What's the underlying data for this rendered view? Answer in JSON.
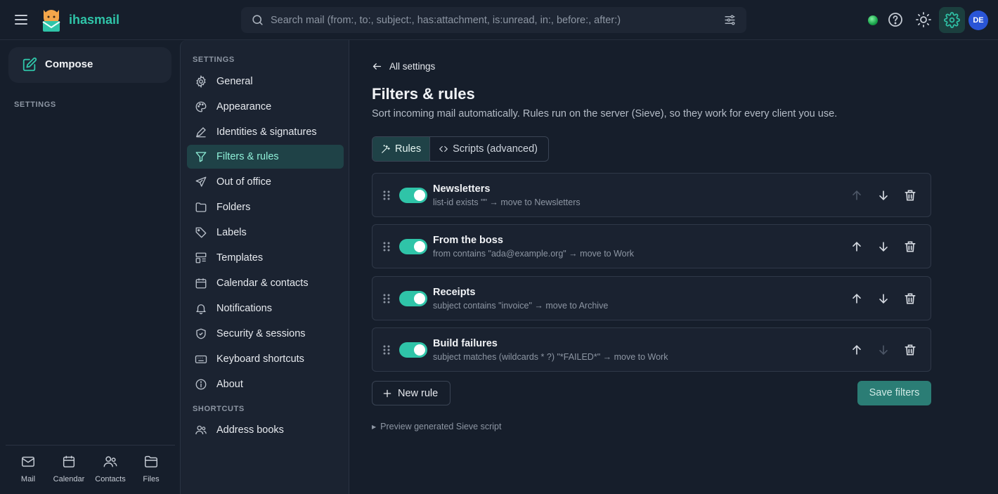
{
  "app": {
    "brand": "ihasmail"
  },
  "search": {
    "placeholder": "Search mail  (from:, to:, subject:, has:attachment, is:unread, in:, before:, after:)"
  },
  "user": {
    "initials": "DE"
  },
  "colors": {
    "accent": "#2fc4a8",
    "active_bg": "#1f4247",
    "background": "#161e2b",
    "avatar": "#2a55d6",
    "save_button": "#2b7d75"
  },
  "leftnav": {
    "compose_label": "Compose",
    "section_label": "SETTINGS",
    "bottom_tabs": [
      {
        "label": "Mail",
        "icon": "mail-icon"
      },
      {
        "label": "Calendar",
        "icon": "calendar-icon"
      },
      {
        "label": "Contacts",
        "icon": "contacts-icon"
      },
      {
        "label": "Files",
        "icon": "folder-icon"
      }
    ]
  },
  "settings_nav": {
    "heading": "SETTINGS",
    "items": [
      {
        "label": "General",
        "icon": "gear-icon"
      },
      {
        "label": "Appearance",
        "icon": "palette-icon"
      },
      {
        "label": "Identities & signatures",
        "icon": "pen-icon"
      },
      {
        "label": "Filters & rules",
        "icon": "filter-icon",
        "active": true
      },
      {
        "label": "Out of office",
        "icon": "plane-icon"
      },
      {
        "label": "Folders",
        "icon": "folder-icon"
      },
      {
        "label": "Labels",
        "icon": "tag-icon"
      },
      {
        "label": "Templates",
        "icon": "template-icon"
      },
      {
        "label": "Calendar & contacts",
        "icon": "calendar-icon"
      },
      {
        "label": "Notifications",
        "icon": "bell-icon"
      },
      {
        "label": "Security & sessions",
        "icon": "shield-icon"
      },
      {
        "label": "Keyboard shortcuts",
        "icon": "keyboard-icon"
      },
      {
        "label": "About",
        "icon": "info-icon"
      }
    ],
    "shortcuts_heading": "SHORTCUTS",
    "shortcuts": [
      {
        "label": "Address books",
        "icon": "users-icon"
      }
    ]
  },
  "main": {
    "back_label": "All settings",
    "title": "Filters & rules",
    "description": "Sort incoming mail automatically. Rules run on the server (Sieve), so they work for every client you use.",
    "tabs": [
      {
        "label": "Rules",
        "active": true
      },
      {
        "label": "Scripts (advanced)"
      }
    ],
    "rules": [
      {
        "name": "Newsletters",
        "desc": "list-id exists \"\" → move to Newsletters",
        "enabled": true,
        "can_up": false,
        "can_down": true
      },
      {
        "name": "From the boss",
        "desc": "from contains \"ada@example.org\" → move to Work",
        "enabled": true,
        "can_up": true,
        "can_down": true
      },
      {
        "name": "Receipts",
        "desc": "subject contains \"invoice\" → move to Archive",
        "enabled": true,
        "can_up": true,
        "can_down": true
      },
      {
        "name": "Build failures",
        "desc": "subject matches (wildcards * ?) \"*FAILED*\" → move to Work",
        "enabled": true,
        "can_up": true,
        "can_down": false
      }
    ],
    "new_rule_label": "New rule",
    "save_label": "Save filters",
    "preview_label": "Preview generated Sieve script"
  }
}
